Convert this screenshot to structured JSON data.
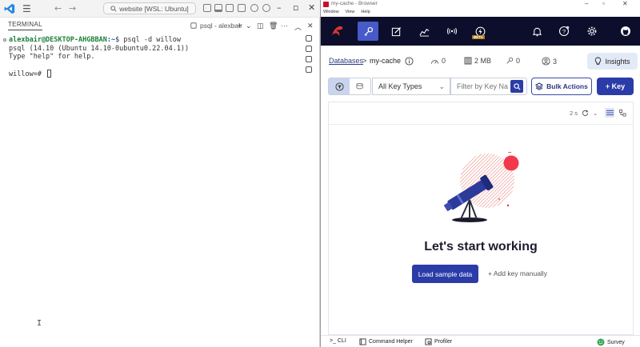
{
  "vscode": {
    "search_text": "website [WSL: Ubuntu]",
    "terminal_tab": "TERMINAL",
    "shell_label": "psql - alexbair",
    "terminal_lines": [
      {
        "user": "alexbair@DESKTOP-AHGBBAN",
        "path": ":~",
        "cmd": "$ psql -d willow"
      },
      {
        "text": "psql (14.10 (Ubuntu 14.10-0ubuntu0.22.04.1))"
      },
      {
        "text": "Type \"help\" for help."
      },
      {
        "text": ""
      },
      {
        "text": "willow=# "
      }
    ],
    "ibeam": "I"
  },
  "browser": {
    "window_title": "my-cache - Browser",
    "menu": [
      "Window",
      "View",
      "Help"
    ],
    "beta_badge": "BETA",
    "breadcrumb": {
      "databases": "Databases",
      "separator": ">",
      "db_name": "my-cache"
    },
    "stats": {
      "ops": "0",
      "memory": "2 MB",
      "keys": "0",
      "clients": "3"
    },
    "insights_label": "Insights",
    "key_type_placeholder": "All Key Types",
    "filter_placeholder": "Filter by Key Na",
    "bulk_actions_label": "Bulk Actions",
    "add_key_label": "+ Key",
    "refresh_interval": "2 s",
    "empty_title": "Let's start working",
    "load_sample_label": "Load sample data",
    "add_manual_label": "+ Add key manually",
    "footer": {
      "cli": ">_ CLI",
      "command_helper": "Command Helper",
      "profiler": "Profiler",
      "survey": "Survey"
    }
  },
  "colors": {
    "brand_red": "#dc382c",
    "primary_blue": "#2b3ca8",
    "nav_dark": "#0d0e2b",
    "active_nav": "#465bc7"
  }
}
